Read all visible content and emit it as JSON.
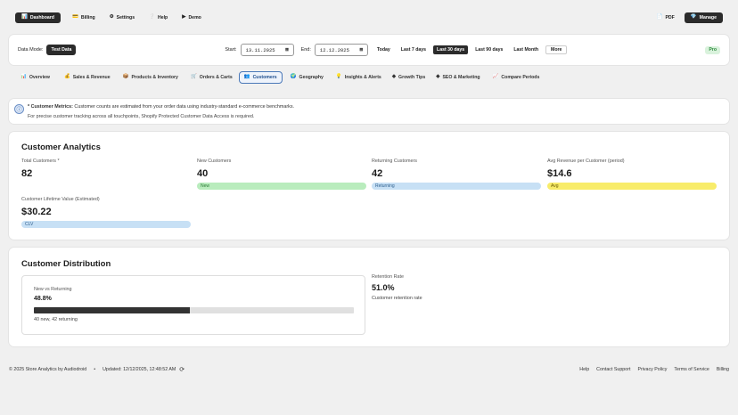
{
  "nav": {
    "dashboard": "Dashboard",
    "billing": "Billing",
    "settings": "Settings",
    "help": "Help",
    "demo": "Demo",
    "pdf": "PDF",
    "manage": "Manage",
    "icons": {
      "dashboard": "📊",
      "billing": "💳",
      "settings": "⚙",
      "help": "❔",
      "demo": "▶",
      "pdf": "📄",
      "manage": "💎"
    }
  },
  "toolbar": {
    "data_mode_label": "Data Mode:",
    "data_mode_value": "Test Data",
    "start_label": "Start:",
    "start_value": "13.11.2025",
    "end_label": "End:",
    "end_value": "12.12.2025",
    "ranges": [
      "Today",
      "Last 7 days",
      "Last 30 days",
      "Last 90 days",
      "Last Month",
      "More"
    ],
    "active_range": "Last 30 days",
    "pro_badge": "Pro"
  },
  "tabs": [
    {
      "icon": "📊",
      "label": "Overview"
    },
    {
      "icon": "💰",
      "label": "Sales & Revenue"
    },
    {
      "icon": "📦",
      "label": "Products & Inventory"
    },
    {
      "icon": "🛒",
      "label": "Orders & Carts"
    },
    {
      "icon": "👥",
      "label": "Customers"
    },
    {
      "icon": "🌍",
      "label": "Geography"
    },
    {
      "icon": "💡",
      "label": "Insights & Alerts"
    },
    {
      "icon": "◆",
      "label": "Growth Tips"
    },
    {
      "icon": "◆",
      "label": "SEO & Marketing"
    },
    {
      "icon": "📈",
      "label": "Compare Periods"
    }
  ],
  "active_tab": "Customers",
  "info": {
    "icon": "ⓘ",
    "bold": "* Customer Metrics:",
    "text": " Customer counts are estimated from your order data using industry-standard e-commerce benchmarks.",
    "line2": "For precise customer tracking across all touchpoints, Shopify Protected Customer Data Access is required."
  },
  "analytics": {
    "title": "Customer Analytics",
    "total": {
      "label": "Total Customers *",
      "value": "82"
    },
    "new": {
      "label": "New Customers",
      "value": "40",
      "tag": "New",
      "color": "#b9ecbd"
    },
    "returning": {
      "label": "Returning Customers",
      "value": "42",
      "tag": "Returning",
      "color": "#c7e0f5"
    },
    "avg": {
      "label": "Avg Revenue per Customer (period)",
      "value": "$14.6",
      "tag": "Avg",
      "color": "#f8ec6a"
    },
    "clv": {
      "label": "Customer Lifetime Value (Estimated)",
      "value": "$30.22",
      "tag": "CLV",
      "color": "#c7e0f5"
    }
  },
  "distribution": {
    "title": "Customer Distribution",
    "box_label": "New vs Returning",
    "percent": "48.8%",
    "percent_value": 48.8,
    "caption": "40 new, 42 returning",
    "retention_label": "Retention Rate",
    "retention_value": "51.0%",
    "retention_caption": "Customer retention rate"
  },
  "footer": {
    "copyright": "© 2025 Store Analytics by Audiodroid",
    "dot": "•",
    "updated": "Updated: 12/12/2025, 12:48:52 AM",
    "refresh_icon": "⟳",
    "links": [
      "Help",
      "Contact Support",
      "Privacy Policy",
      "Terms of Service",
      "Billing"
    ]
  }
}
